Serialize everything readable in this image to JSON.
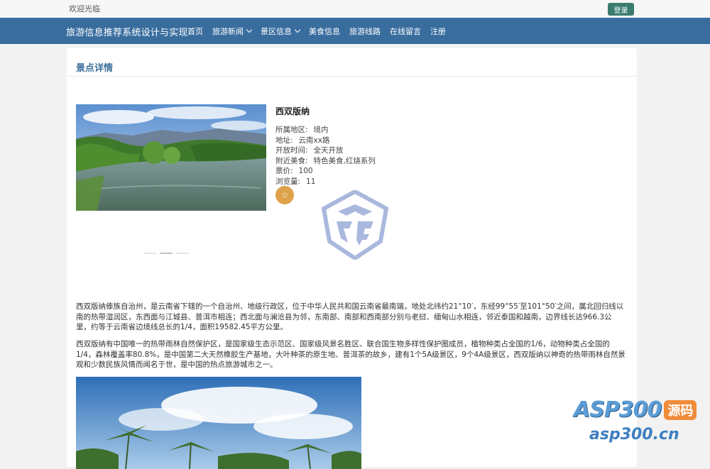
{
  "topbar": {
    "welcome": "欢迎光临",
    "login_label": "登录"
  },
  "navbar": {
    "brand": "旅游信息推荐系统设计与实现",
    "items": [
      {
        "label": "首页",
        "has_dropdown": false
      },
      {
        "label": "旅游新闻",
        "has_dropdown": true
      },
      {
        "label": "景区信息",
        "has_dropdown": true
      },
      {
        "label": "美食信息",
        "has_dropdown": false
      },
      {
        "label": "旅游线路",
        "has_dropdown": false
      },
      {
        "label": "在线留言",
        "has_dropdown": false
      },
      {
        "label": "注册",
        "has_dropdown": false
      }
    ]
  },
  "panel": {
    "title": "景点详情"
  },
  "spot": {
    "name": "西双版纳",
    "fields": [
      {
        "label": "所属地区:",
        "value": "境内"
      },
      {
        "label": "地址:",
        "value": "云南xx路"
      },
      {
        "label": "开放时间:",
        "value": "全天开放"
      },
      {
        "label": "附近美食:",
        "value": "特色美食,红烧系列"
      },
      {
        "label": "票价:",
        "value": "100"
      },
      {
        "label": "浏览量:",
        "value": "11"
      }
    ],
    "favorite_icon": "star-outline-icon"
  },
  "description": {
    "p1": "西双版纳傣族自治州，是云南省下辖的一个自治州、地级行政区，位于中华人民共和国云南省最南端，地处北纬约21°10′，东经99°55′至101°50′之间，属北回归线以南的热带湿润区，东西面与江城县、普洱市相连；西北面与澜沧县为邻，东南部、南部和西南部分别与老挝、缅甸山水相连，邻近泰国和越南，边界线长达966.3公里，约等于云南省边境线总长的1/4，面积19582.45平方公里。",
    "p2": "西双版纳有中国唯一的热带雨林自然保护区，是国家级生态示范区、国家级风景名胜区、联合国生物多样性保护圈成员，植物种类占全国的1/6，动物种类占全国的1/4，森林覆盖率80.8%，是中国第二大天然橡胶生产基地，大叶种茶的原生地、普洱茶的故乡，建有1个5A级景区，9个4A级景区，西双版纳以神奇的热带雨林自然景观和少数民族风情而闻名于世，是中国的热点旅游城市之一。"
  },
  "watermark": {
    "brand": "ASP300",
    "badge": "源码",
    "url": "asp300.cn"
  },
  "colors": {
    "navbar": "#396d9e",
    "title": "#3d6f9a",
    "login": "#3a7d6f",
    "favorite": "#dda24a"
  }
}
